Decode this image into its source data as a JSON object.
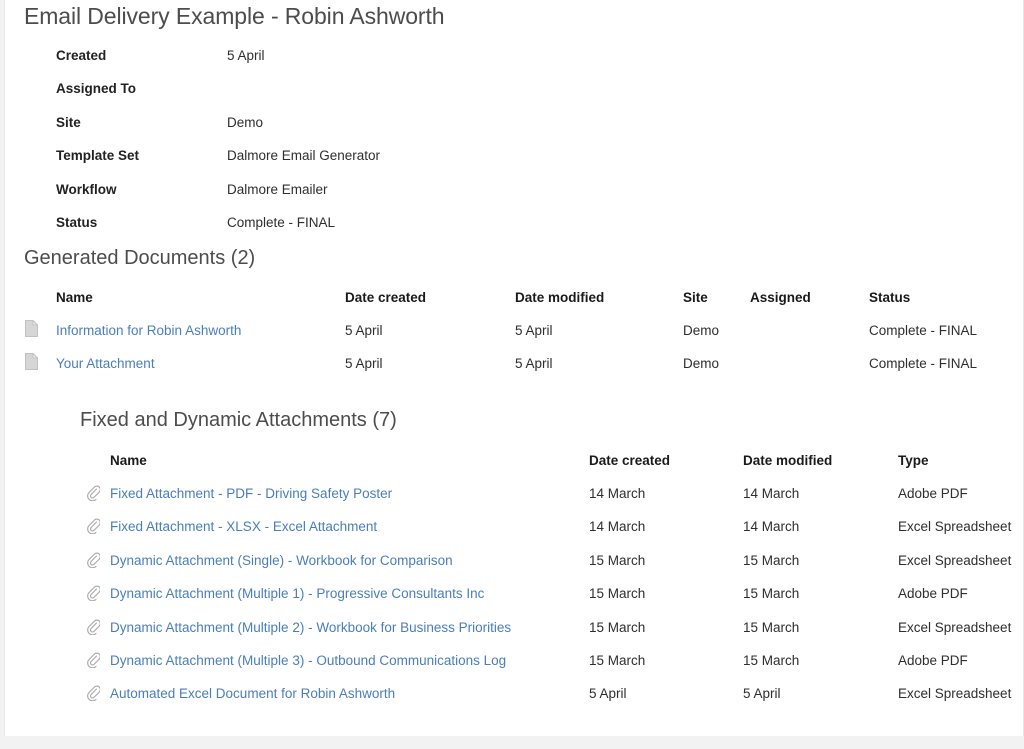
{
  "page": {
    "title": "Email Delivery Example - Robin Ashworth",
    "link_color": "#4a7ebb",
    "heading_color": "#4c4c4c",
    "background": "#f2f2f2",
    "card_background": "#ffffff"
  },
  "metadata": {
    "rows": [
      {
        "label": "Created",
        "value": "5 April"
      },
      {
        "label": "Assigned To",
        "value": ""
      },
      {
        "label": "Site",
        "value": "Demo"
      },
      {
        "label": "Template Set",
        "value": "Dalmore Email Generator"
      },
      {
        "label": "Workflow",
        "value": "Dalmore Emailer"
      },
      {
        "label": "Status",
        "value": "Complete - FINAL"
      }
    ]
  },
  "generated_documents": {
    "heading": "Generated Documents (2)",
    "count": 2,
    "columns": {
      "name": "Name",
      "date_created": "Date created",
      "date_modified": "Date modified",
      "site": "Site",
      "assigned": "Assigned",
      "status": "Status"
    },
    "rows": [
      {
        "icon": "document-icon",
        "name": "Information for Robin Ashworth",
        "date_created": "5 April",
        "date_modified": "5 April",
        "site": "Demo",
        "assigned": "",
        "status": "Complete - FINAL"
      },
      {
        "icon": "document-icon",
        "name": "Your Attachment",
        "date_created": "5 April",
        "date_modified": "5 April",
        "site": "Demo",
        "assigned": "",
        "status": "Complete - FINAL"
      }
    ]
  },
  "attachments": {
    "heading": "Fixed and Dynamic Attachments (7)",
    "count": 7,
    "columns": {
      "name": "Name",
      "date_created": "Date created",
      "date_modified": "Date modified",
      "type": "Type"
    },
    "rows": [
      {
        "icon": "paperclip-icon",
        "name": "Fixed Attachment - PDF - Driving Safety Poster",
        "date_created": "14 March",
        "date_modified": "14 March",
        "type": "Adobe PDF"
      },
      {
        "icon": "paperclip-icon",
        "name": "Fixed Attachment - XLSX - Excel Attachment",
        "date_created": "14 March",
        "date_modified": "14 March",
        "type": "Excel Spreadsheet"
      },
      {
        "icon": "paperclip-icon",
        "name": "Dynamic Attachment (Single) - Workbook for Comparison",
        "date_created": "15 March",
        "date_modified": "15 March",
        "type": "Excel Spreadsheet"
      },
      {
        "icon": "paperclip-icon",
        "name": "Dynamic Attachment (Multiple 1) - Progressive Consultants Inc",
        "date_created": "15 March",
        "date_modified": "15 March",
        "type": "Adobe PDF"
      },
      {
        "icon": "paperclip-icon",
        "name": "Dynamic Attachment (Multiple 2) - Workbook for Business Priorities",
        "date_created": "15 March",
        "date_modified": "15 March",
        "type": "Excel Spreadsheet"
      },
      {
        "icon": "paperclip-icon",
        "name": "Dynamic Attachment (Multiple 3) - Outbound Communications Log",
        "date_created": "15 March",
        "date_modified": "15 March",
        "type": "Adobe PDF"
      },
      {
        "icon": "paperclip-icon",
        "name": "Automated Excel Document for Robin Ashworth",
        "date_created": "5 April",
        "date_modified": "5 April",
        "type": "Excel Spreadsheet"
      }
    ]
  }
}
